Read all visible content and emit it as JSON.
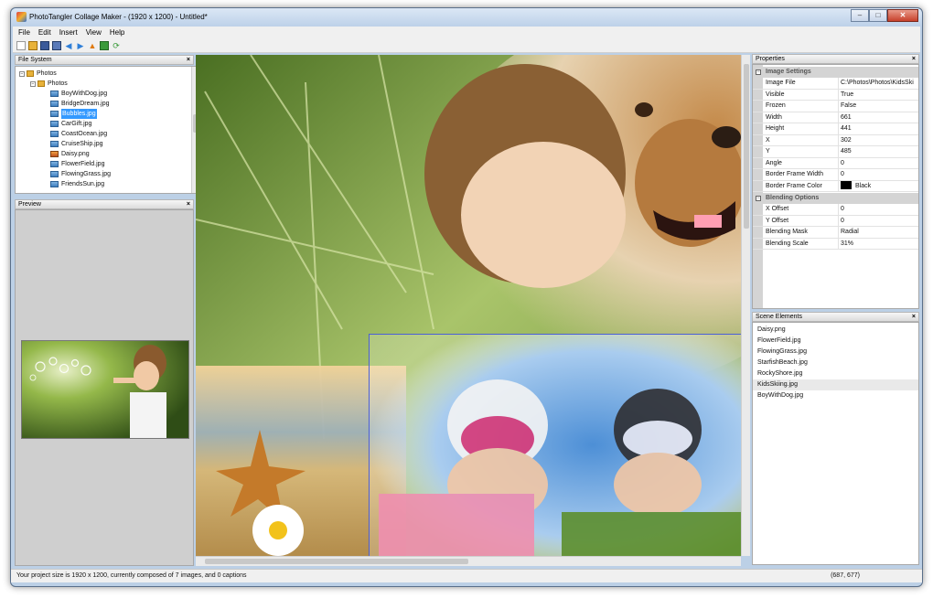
{
  "window": {
    "title": "PhotoTangler Collage Maker - (1920 x 1200) - Untitled*",
    "controls": [
      "–",
      "□",
      "✕"
    ]
  },
  "menu": [
    "File",
    "Edit",
    "Insert",
    "View",
    "Help"
  ],
  "toolbar": [
    "new-icon",
    "open-icon",
    "save-icon",
    "save-as-icon",
    "back-icon",
    "forward-icon",
    "up-icon",
    "folder-icon",
    "refresh-icon"
  ],
  "file_system": {
    "title": "File System",
    "root": "Photos",
    "folder": "Photos",
    "files": [
      "BoyWithDog.jpg",
      "BridgeDream.jpg",
      "Bubbles.jpg",
      "CarGift.jpg",
      "CoastOcean.jpg",
      "CruiseShip.jpg",
      "Daisy.png",
      "FlowerField.jpg",
      "FlowingGrass.jpg",
      "FriendsSun.jpg"
    ],
    "selected": "Bubbles.jpg"
  },
  "preview": {
    "title": "Preview"
  },
  "properties": {
    "title": "Properties",
    "categories": [
      {
        "name": "Image Settings",
        "rows": [
          {
            "name": "Image File",
            "value": "C:\\Photos\\Photos\\KidsSki"
          },
          {
            "name": "Visible",
            "value": "True"
          },
          {
            "name": "Frozen",
            "value": "False"
          },
          {
            "name": "Width",
            "value": "661"
          },
          {
            "name": "Height",
            "value": "441"
          },
          {
            "name": "X",
            "value": "302"
          },
          {
            "name": "Y",
            "value": "485"
          },
          {
            "name": "Angle",
            "value": "0"
          },
          {
            "name": "Border Frame Width",
            "value": "0"
          },
          {
            "name": "Border Frame Color",
            "value": "Black",
            "swatch": "#000000"
          }
        ]
      },
      {
        "name": "Blending Options",
        "rows": [
          {
            "name": "X Offset",
            "value": "0"
          },
          {
            "name": "Y Offset",
            "value": "0"
          },
          {
            "name": "Blending Mask",
            "value": "Radial"
          },
          {
            "name": "Blending Scale",
            "value": "31%"
          }
        ]
      }
    ]
  },
  "scene": {
    "title": "Scene Elements",
    "items": [
      "Daisy.png",
      "FlowerField.jpg",
      "FlowingGrass.jpg",
      "StarfishBeach.jpg",
      "RockyShore.jpg",
      "KidsSkiing.jpg",
      "BoyWithDog.jpg"
    ],
    "selected": "KidsSkiing.jpg"
  },
  "status": {
    "message": "Your project size is 1920 x 1200, currently composed of 7 images, and 0 captions",
    "coords": "(687, 677)"
  },
  "colors": {
    "accent": "#3399ff",
    "selection_frame": "#4b5fd6",
    "titlebar": "#c9daf0"
  }
}
